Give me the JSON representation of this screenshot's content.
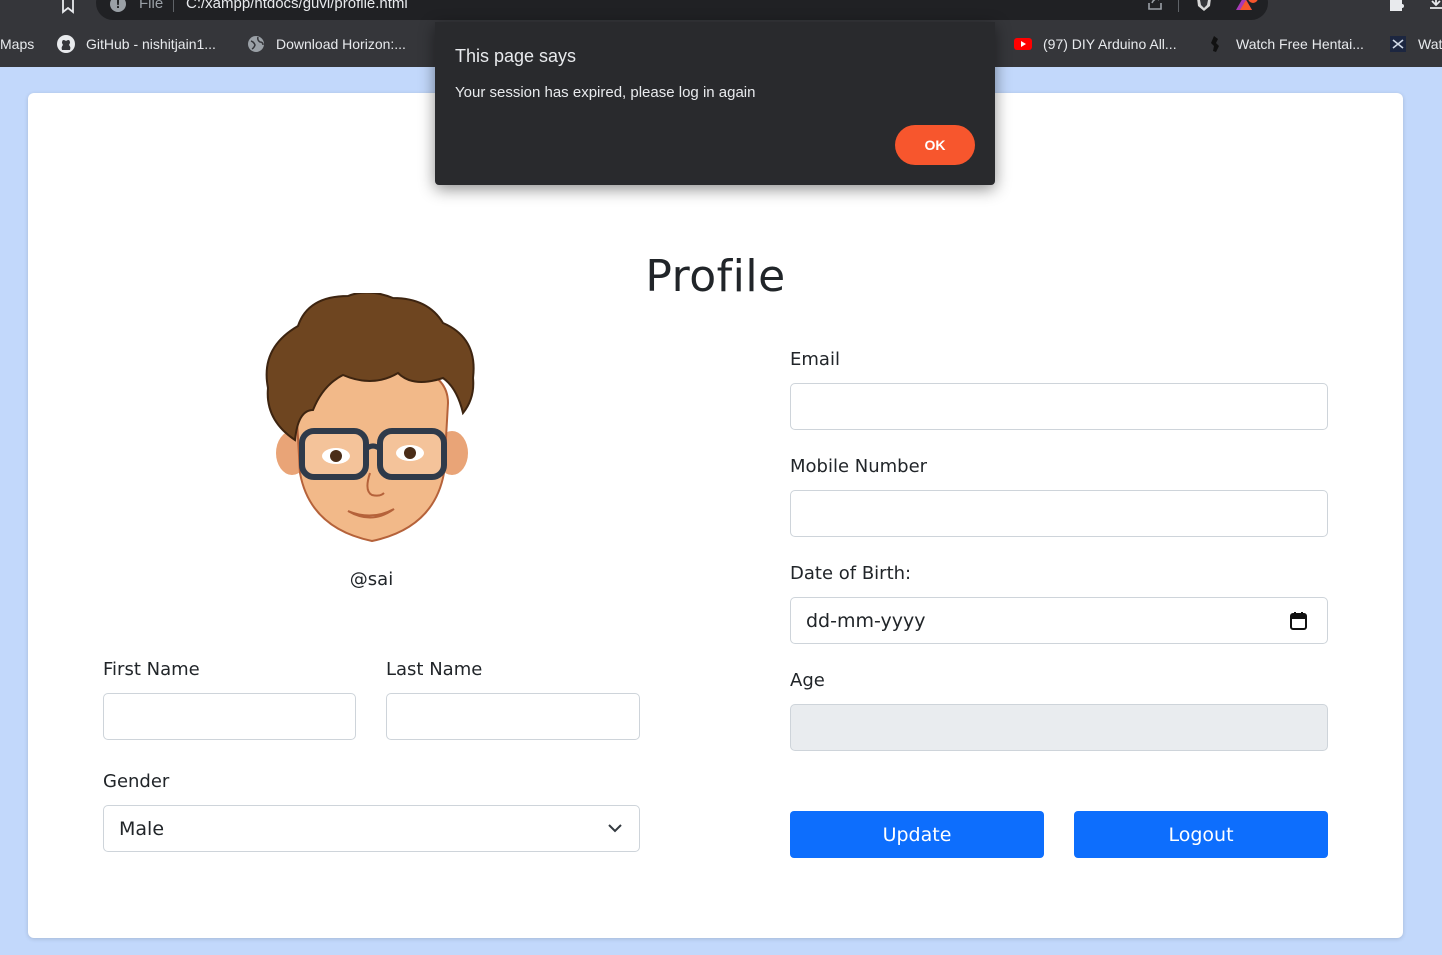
{
  "browser": {
    "address_scheme": "File",
    "address_url": "C:/xampp/htdocs/guvi/profile.html",
    "bookmarks": [
      {
        "label": "Maps",
        "icon": "maps-icon"
      },
      {
        "label": "GitHub - nishitjain1...",
        "icon": "github-icon"
      },
      {
        "label": "Download Horizon:...",
        "icon": "globe-icon"
      },
      {
        "label": "(97) DIY Arduino All...",
        "icon": "youtube-icon"
      },
      {
        "label": "Watch Free Hentai...",
        "icon": "site-icon"
      },
      {
        "label": "Wat",
        "icon": "site-icon"
      }
    ]
  },
  "dialog": {
    "title": "This page says",
    "message": "Your session has expired, please log in again",
    "ok_label": "OK",
    "ok_color": "#f7562d"
  },
  "profile": {
    "title": "Profile",
    "username": "@sai",
    "first_name": {
      "label": "First Name",
      "value": ""
    },
    "last_name": {
      "label": "Last Name",
      "value": ""
    },
    "gender": {
      "label": "Gender",
      "value": "Male"
    },
    "email": {
      "label": "Email",
      "value": ""
    },
    "mobile": {
      "label": "Mobile Number",
      "value": ""
    },
    "dob": {
      "label": "Date of Birth:",
      "value": "dd-mm-yyyy"
    },
    "age": {
      "label": "Age",
      "value": ""
    },
    "update_label": "Update",
    "logout_label": "Logout",
    "accent_color": "#0d6efd"
  }
}
